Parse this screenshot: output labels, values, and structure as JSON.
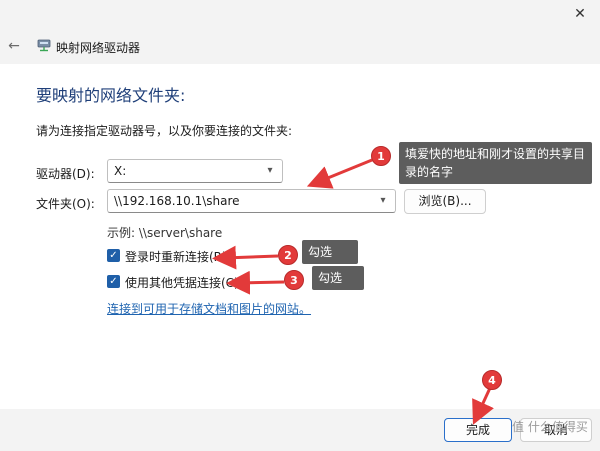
{
  "window": {
    "close_glyph": "✕",
    "back_glyph": "←"
  },
  "header": {
    "title": "映射网络驱动器",
    "icon": "network-drive-icon"
  },
  "main": {
    "title": "要映射的网络文件夹:",
    "description": "请为连接指定驱动器号，以及你要连接的文件夹:",
    "drive_label": "驱动器(D):",
    "drive_value": "X:",
    "folder_label": "文件夹(O):",
    "folder_value": "\\\\192.168.10.1\\share",
    "browse_label": "浏览(B)...",
    "example": "示例: \\\\server\\share",
    "reconnect_label": "登录时重新连接(R)",
    "reconnect_checked": true,
    "other_credentials_label": "使用其他凭据连接(C)",
    "other_credentials_checked": true,
    "link_text": "连接到可用于存储文档和图片的网站。"
  },
  "footer": {
    "finish_label": "完成",
    "cancel_label": "取消"
  },
  "annotations": [
    {
      "number": "1",
      "text": "填爱快的地址和刚才设置的共享目录的名字"
    },
    {
      "number": "2",
      "text": "勾选"
    },
    {
      "number": "3",
      "text": "勾选"
    },
    {
      "number": "4",
      "text": ""
    }
  ],
  "watermark": "值 什么值得买",
  "colors": {
    "accent": "#1f5fa8",
    "title": "#1f3f79",
    "annotation": "#e23a3a",
    "tooltip": "#5d5d5d"
  }
}
